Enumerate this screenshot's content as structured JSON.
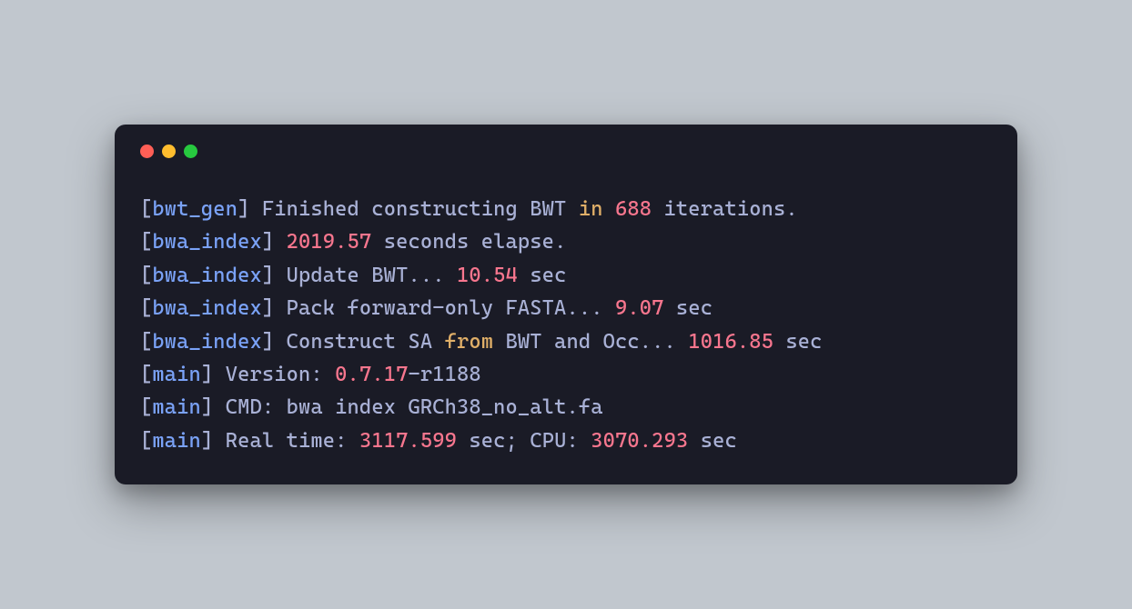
{
  "lines": [
    {
      "tokens": [
        {
          "cls": "bracket",
          "t": "["
        },
        {
          "cls": "tag",
          "t": "bwt_gen"
        },
        {
          "cls": "bracket",
          "t": "]"
        },
        {
          "cls": "text",
          "t": " Finished constructing BWT "
        },
        {
          "cls": "keyword",
          "t": "in"
        },
        {
          "cls": "text",
          "t": " "
        },
        {
          "cls": "number",
          "t": "688"
        },
        {
          "cls": "text",
          "t": " iterations"
        },
        {
          "cls": "punct",
          "t": "."
        }
      ]
    },
    {
      "tokens": [
        {
          "cls": "bracket",
          "t": "["
        },
        {
          "cls": "tag",
          "t": "bwa_index"
        },
        {
          "cls": "bracket",
          "t": "]"
        },
        {
          "cls": "text",
          "t": " "
        },
        {
          "cls": "number",
          "t": "2019.57"
        },
        {
          "cls": "text",
          "t": " seconds elapse"
        },
        {
          "cls": "punct",
          "t": "."
        }
      ]
    },
    {
      "tokens": [
        {
          "cls": "bracket",
          "t": "["
        },
        {
          "cls": "tag",
          "t": "bwa_index"
        },
        {
          "cls": "bracket",
          "t": "]"
        },
        {
          "cls": "text",
          "t": " Update BWT"
        },
        {
          "cls": "punct",
          "t": "..."
        },
        {
          "cls": "text",
          "t": " "
        },
        {
          "cls": "number",
          "t": "10.54"
        },
        {
          "cls": "text",
          "t": " sec"
        }
      ]
    },
    {
      "tokens": [
        {
          "cls": "bracket",
          "t": "["
        },
        {
          "cls": "tag",
          "t": "bwa_index"
        },
        {
          "cls": "bracket",
          "t": "]"
        },
        {
          "cls": "text",
          "t": " Pack forward-only FASTA"
        },
        {
          "cls": "punct",
          "t": "..."
        },
        {
          "cls": "text",
          "t": " "
        },
        {
          "cls": "number",
          "t": "9.07"
        },
        {
          "cls": "text",
          "t": " sec"
        }
      ]
    },
    {
      "tokens": [
        {
          "cls": "bracket",
          "t": "["
        },
        {
          "cls": "tag",
          "t": "bwa_index"
        },
        {
          "cls": "bracket",
          "t": "]"
        },
        {
          "cls": "text",
          "t": " Construct SA "
        },
        {
          "cls": "keyword",
          "t": "from"
        },
        {
          "cls": "text",
          "t": " BWT and Occ"
        },
        {
          "cls": "punct",
          "t": "..."
        },
        {
          "cls": "text",
          "t": " "
        },
        {
          "cls": "number",
          "t": "1016.85"
        },
        {
          "cls": "text",
          "t": " sec"
        }
      ]
    },
    {
      "tokens": [
        {
          "cls": "bracket",
          "t": "["
        },
        {
          "cls": "tag",
          "t": "main"
        },
        {
          "cls": "bracket",
          "t": "]"
        },
        {
          "cls": "text",
          "t": " Version: "
        },
        {
          "cls": "number",
          "t": "0.7.17"
        },
        {
          "cls": "text",
          "t": "-r1188"
        }
      ]
    },
    {
      "tokens": [
        {
          "cls": "bracket",
          "t": "["
        },
        {
          "cls": "tag",
          "t": "main"
        },
        {
          "cls": "bracket",
          "t": "]"
        },
        {
          "cls": "text",
          "t": " CMD: bwa index GRCh38_no_alt"
        },
        {
          "cls": "punct",
          "t": "."
        },
        {
          "cls": "text",
          "t": "fa"
        }
      ]
    },
    {
      "tokens": [
        {
          "cls": "bracket",
          "t": "["
        },
        {
          "cls": "tag",
          "t": "main"
        },
        {
          "cls": "bracket",
          "t": "]"
        },
        {
          "cls": "text",
          "t": " Real time: "
        },
        {
          "cls": "number",
          "t": "3117.599"
        },
        {
          "cls": "text",
          "t": " sec"
        },
        {
          "cls": "punct",
          "t": ";"
        },
        {
          "cls": "text",
          "t": " CPU: "
        },
        {
          "cls": "number",
          "t": "3070.293"
        },
        {
          "cls": "text",
          "t": " sec"
        }
      ]
    }
  ]
}
